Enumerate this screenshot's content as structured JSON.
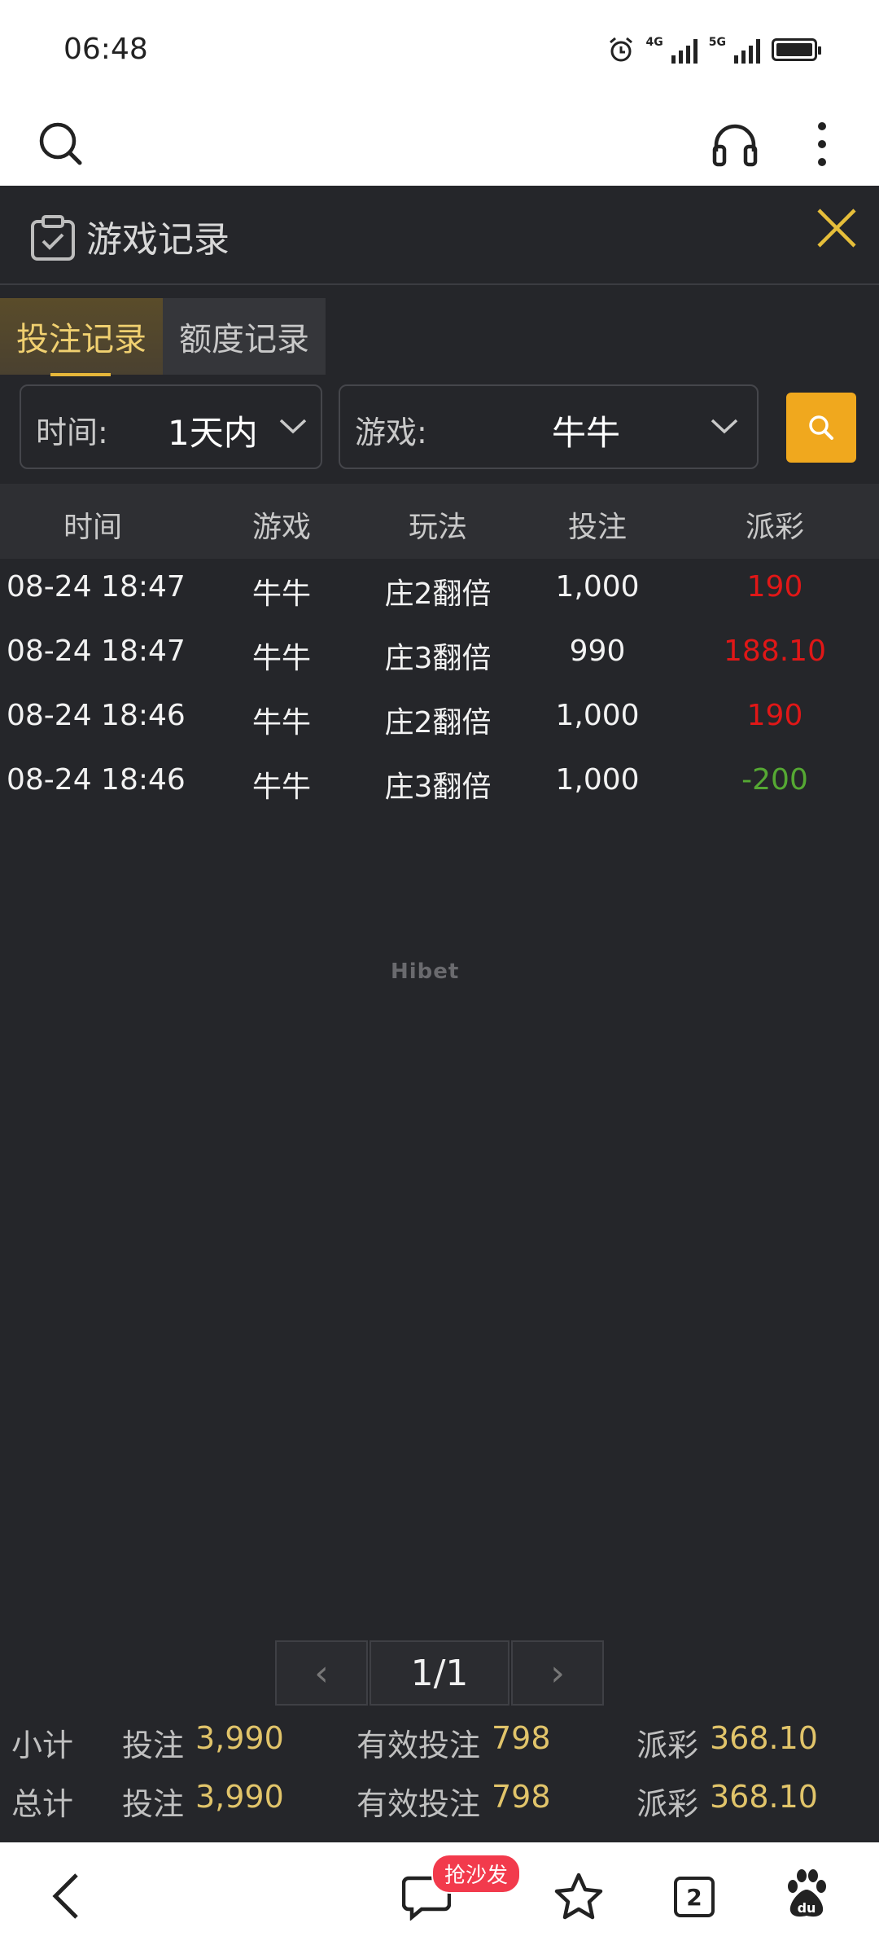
{
  "status": {
    "time": "06:48",
    "net1": "4G",
    "net2": "5G"
  },
  "panel": {
    "title": "游戏记录",
    "tabs": [
      {
        "label": "投注记录",
        "active": true
      },
      {
        "label": "额度记录",
        "active": false
      }
    ],
    "filters": {
      "time_label": "时间:",
      "time_value": "1天内",
      "game_label": "游戏:",
      "game_value": "牛牛"
    }
  },
  "table": {
    "headers": [
      "时间",
      "游戏",
      "玩法",
      "投注",
      "派彩"
    ],
    "rows": [
      {
        "time": "08-24 18:47",
        "game": "牛牛",
        "play": "庄2翻倍",
        "bet": "1,000",
        "payout": "190",
        "payout_color": "#e01717"
      },
      {
        "time": "08-24 18:47",
        "game": "牛牛",
        "play": "庄3翻倍",
        "bet": "990",
        "payout": "188.10",
        "payout_color": "#e01717"
      },
      {
        "time": "08-24 18:46",
        "game": "牛牛",
        "play": "庄2翻倍",
        "bet": "1,000",
        "payout": "190",
        "payout_color": "#e01717"
      },
      {
        "time": "08-24 18:46",
        "game": "牛牛",
        "play": "庄3翻倍",
        "bet": "1,000",
        "payout": "-200",
        "payout_color": "#55a833"
      }
    ]
  },
  "watermark": "Hibet",
  "pagination": {
    "text": "1/1",
    "prev": "‹",
    "next": "›"
  },
  "summary": {
    "subtotal": {
      "label": "小计",
      "bet_label": "投注",
      "bet": "3,990",
      "valid_label": "有效投注",
      "valid": "798",
      "payout_label": "派彩",
      "payout": "368.10"
    },
    "total": {
      "label": "总计",
      "bet_label": "投注",
      "bet": "3,990",
      "valid_label": "有效投注",
      "valid": "798",
      "payout_label": "派彩",
      "payout": "368.10"
    }
  },
  "bottom_nav": {
    "badge": "抢沙发",
    "tab_count": "2"
  },
  "colors": {
    "accent": "#f0a81e",
    "panel_bg": "#25262a",
    "gold_text": "#e1c46a"
  }
}
